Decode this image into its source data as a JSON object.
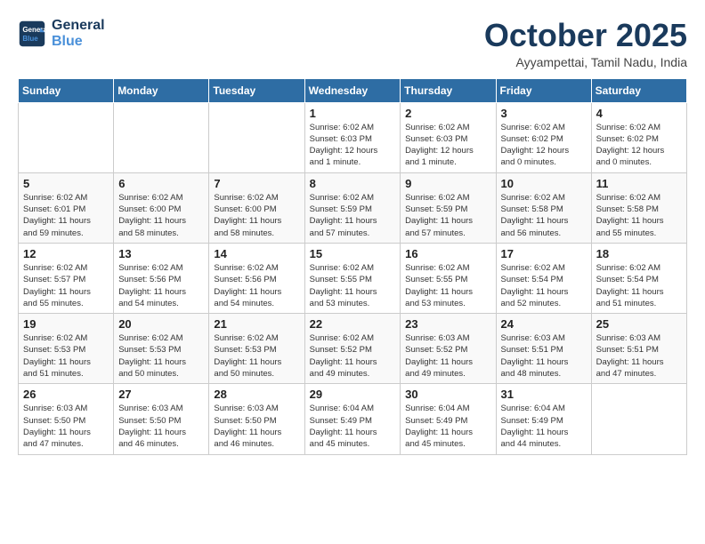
{
  "header": {
    "logo_line1": "General",
    "logo_line2": "Blue",
    "month": "October 2025",
    "location": "Ayyampettai, Tamil Nadu, India"
  },
  "days_of_week": [
    "Sunday",
    "Monday",
    "Tuesday",
    "Wednesday",
    "Thursday",
    "Friday",
    "Saturday"
  ],
  "weeks": [
    [
      {
        "num": "",
        "info": ""
      },
      {
        "num": "",
        "info": ""
      },
      {
        "num": "",
        "info": ""
      },
      {
        "num": "1",
        "info": "Sunrise: 6:02 AM\nSunset: 6:03 PM\nDaylight: 12 hours\nand 1 minute."
      },
      {
        "num": "2",
        "info": "Sunrise: 6:02 AM\nSunset: 6:03 PM\nDaylight: 12 hours\nand 1 minute."
      },
      {
        "num": "3",
        "info": "Sunrise: 6:02 AM\nSunset: 6:02 PM\nDaylight: 12 hours\nand 0 minutes."
      },
      {
        "num": "4",
        "info": "Sunrise: 6:02 AM\nSunset: 6:02 PM\nDaylight: 12 hours\nand 0 minutes."
      }
    ],
    [
      {
        "num": "5",
        "info": "Sunrise: 6:02 AM\nSunset: 6:01 PM\nDaylight: 11 hours\nand 59 minutes."
      },
      {
        "num": "6",
        "info": "Sunrise: 6:02 AM\nSunset: 6:00 PM\nDaylight: 11 hours\nand 58 minutes."
      },
      {
        "num": "7",
        "info": "Sunrise: 6:02 AM\nSunset: 6:00 PM\nDaylight: 11 hours\nand 58 minutes."
      },
      {
        "num": "8",
        "info": "Sunrise: 6:02 AM\nSunset: 5:59 PM\nDaylight: 11 hours\nand 57 minutes."
      },
      {
        "num": "9",
        "info": "Sunrise: 6:02 AM\nSunset: 5:59 PM\nDaylight: 11 hours\nand 57 minutes."
      },
      {
        "num": "10",
        "info": "Sunrise: 6:02 AM\nSunset: 5:58 PM\nDaylight: 11 hours\nand 56 minutes."
      },
      {
        "num": "11",
        "info": "Sunrise: 6:02 AM\nSunset: 5:58 PM\nDaylight: 11 hours\nand 55 minutes."
      }
    ],
    [
      {
        "num": "12",
        "info": "Sunrise: 6:02 AM\nSunset: 5:57 PM\nDaylight: 11 hours\nand 55 minutes."
      },
      {
        "num": "13",
        "info": "Sunrise: 6:02 AM\nSunset: 5:56 PM\nDaylight: 11 hours\nand 54 minutes."
      },
      {
        "num": "14",
        "info": "Sunrise: 6:02 AM\nSunset: 5:56 PM\nDaylight: 11 hours\nand 54 minutes."
      },
      {
        "num": "15",
        "info": "Sunrise: 6:02 AM\nSunset: 5:55 PM\nDaylight: 11 hours\nand 53 minutes."
      },
      {
        "num": "16",
        "info": "Sunrise: 6:02 AM\nSunset: 5:55 PM\nDaylight: 11 hours\nand 53 minutes."
      },
      {
        "num": "17",
        "info": "Sunrise: 6:02 AM\nSunset: 5:54 PM\nDaylight: 11 hours\nand 52 minutes."
      },
      {
        "num": "18",
        "info": "Sunrise: 6:02 AM\nSunset: 5:54 PM\nDaylight: 11 hours\nand 51 minutes."
      }
    ],
    [
      {
        "num": "19",
        "info": "Sunrise: 6:02 AM\nSunset: 5:53 PM\nDaylight: 11 hours\nand 51 minutes."
      },
      {
        "num": "20",
        "info": "Sunrise: 6:02 AM\nSunset: 5:53 PM\nDaylight: 11 hours\nand 50 minutes."
      },
      {
        "num": "21",
        "info": "Sunrise: 6:02 AM\nSunset: 5:53 PM\nDaylight: 11 hours\nand 50 minutes."
      },
      {
        "num": "22",
        "info": "Sunrise: 6:02 AM\nSunset: 5:52 PM\nDaylight: 11 hours\nand 49 minutes."
      },
      {
        "num": "23",
        "info": "Sunrise: 6:03 AM\nSunset: 5:52 PM\nDaylight: 11 hours\nand 49 minutes."
      },
      {
        "num": "24",
        "info": "Sunrise: 6:03 AM\nSunset: 5:51 PM\nDaylight: 11 hours\nand 48 minutes."
      },
      {
        "num": "25",
        "info": "Sunrise: 6:03 AM\nSunset: 5:51 PM\nDaylight: 11 hours\nand 47 minutes."
      }
    ],
    [
      {
        "num": "26",
        "info": "Sunrise: 6:03 AM\nSunset: 5:50 PM\nDaylight: 11 hours\nand 47 minutes."
      },
      {
        "num": "27",
        "info": "Sunrise: 6:03 AM\nSunset: 5:50 PM\nDaylight: 11 hours\nand 46 minutes."
      },
      {
        "num": "28",
        "info": "Sunrise: 6:03 AM\nSunset: 5:50 PM\nDaylight: 11 hours\nand 46 minutes."
      },
      {
        "num": "29",
        "info": "Sunrise: 6:04 AM\nSunset: 5:49 PM\nDaylight: 11 hours\nand 45 minutes."
      },
      {
        "num": "30",
        "info": "Sunrise: 6:04 AM\nSunset: 5:49 PM\nDaylight: 11 hours\nand 45 minutes."
      },
      {
        "num": "31",
        "info": "Sunrise: 6:04 AM\nSunset: 5:49 PM\nDaylight: 11 hours\nand 44 minutes."
      },
      {
        "num": "",
        "info": ""
      }
    ]
  ]
}
